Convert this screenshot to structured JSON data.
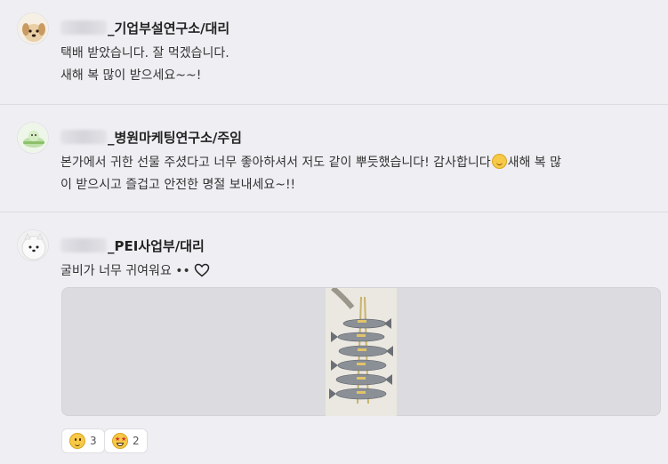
{
  "comments": [
    {
      "author_suffix": "_기업부설연구소/대리",
      "avatar_icon": "puppy-avatar-icon",
      "lines": [
        "택배 받았습니다. 잘 먹겠습니다.",
        "새해 복 많이 받으세요~~!"
      ]
    },
    {
      "author_suffix": "_병원마케팅연구소/주임",
      "avatar_icon": "cartoon-avatar-icon",
      "line1_before_emoji": "본가에서 귀한 선물 주셨다고 너무 좋아하셔서 저도 같이 뿌듯했습니다! 감사합니다",
      "line1_after_emoji": "새해 복 많",
      "line2": "이 받으시고 즐겁고 안전한 명절 보내세요~!!"
    },
    {
      "author_suffix": "_PEI사업부/대리",
      "avatar_icon": "pomeranian-avatar-icon",
      "text": "굴비가 너무 귀여워요 ••",
      "image_icon": "dried-fish-photo",
      "reactions": [
        {
          "emoji": "smiling-face-icon",
          "count": "3"
        },
        {
          "emoji": "star-struck-face-icon",
          "count": "2"
        }
      ]
    }
  ],
  "colors": {
    "background": "#efeff3",
    "separator": "#dcdce1",
    "emoji": "#f7c948"
  }
}
